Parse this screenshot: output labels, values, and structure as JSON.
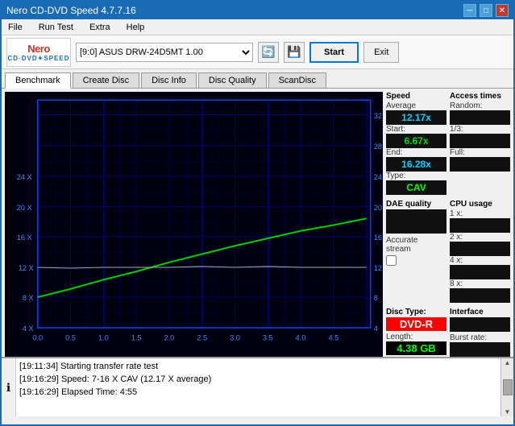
{
  "window": {
    "title": "Nero CD-DVD Speed 4.7.7.16",
    "controls": [
      "minimize",
      "maximize",
      "close"
    ]
  },
  "menu": {
    "items": [
      "File",
      "Run Test",
      "Extra",
      "Help"
    ]
  },
  "toolbar": {
    "logo_top": "nero",
    "logo_bottom": "CD·DVD•SPEED",
    "drive_value": "[9:0]  ASUS DRW-24D5MT 1.00",
    "start_label": "Start",
    "exit_label": "Exit"
  },
  "tabs": [
    {
      "label": "Benchmark",
      "active": true
    },
    {
      "label": "Create Disc"
    },
    {
      "label": "Disc Info"
    },
    {
      "label": "Disc Quality"
    },
    {
      "label": "ScanDisc"
    }
  ],
  "chart": {
    "bg_color": "#000000",
    "grid_color": "#0000aa",
    "line_color_green": "#00cc00",
    "line_color_gray": "#888888",
    "x_labels": [
      "0.0",
      "0.5",
      "1.0",
      "1.5",
      "2.0",
      "2.5",
      "3.0",
      "3.5",
      "4.0",
      "4.5"
    ],
    "y_left_labels": [
      "4 X",
      "8 X",
      "12 X",
      "16 X",
      "20 X",
      "24 X"
    ],
    "y_right_labels": [
      "4",
      "8",
      "12",
      "16",
      "20",
      "24",
      "28",
      "32"
    ]
  },
  "stats": {
    "speed_header": "Speed",
    "average_label": "Average",
    "average_value": "12.17x",
    "start_label": "Start:",
    "start_value": "6.67x",
    "end_label": "End:",
    "end_value": "16.28x",
    "type_label": "Type:",
    "type_value": "CAV",
    "dae_label": "DAE quality",
    "dae_value": "",
    "accurate_label": "Accurate",
    "accurate_stream_label": "stream",
    "disc_type_label": "Disc",
    "disc_type_sub": "Type:",
    "disc_type_value": "DVD-R",
    "length_label": "Length:",
    "length_value": "4.38 GB",
    "access_header": "Access times",
    "random_label": "Random:",
    "random_value": "",
    "one_third_label": "1/3:",
    "one_third_value": "",
    "full_label": "Full:",
    "full_value": "",
    "cpu_header": "CPU usage",
    "cpu_1x_label": "1 x:",
    "cpu_1x_value": "",
    "cpu_2x_label": "2 x:",
    "cpu_2x_value": "",
    "cpu_4x_label": "4 x:",
    "cpu_4x_value": "",
    "cpu_8x_label": "8 x:",
    "cpu_8x_value": "",
    "interface_label": "Interface",
    "burst_label": "Burst rate:"
  },
  "log": {
    "lines": [
      "[19:11:34]  Starting transfer rate test",
      "[19:16:29]  Speed: 7-16 X CAV (12.17 X average)",
      "[19:16:29]  Elapsed Time: 4:55"
    ]
  }
}
